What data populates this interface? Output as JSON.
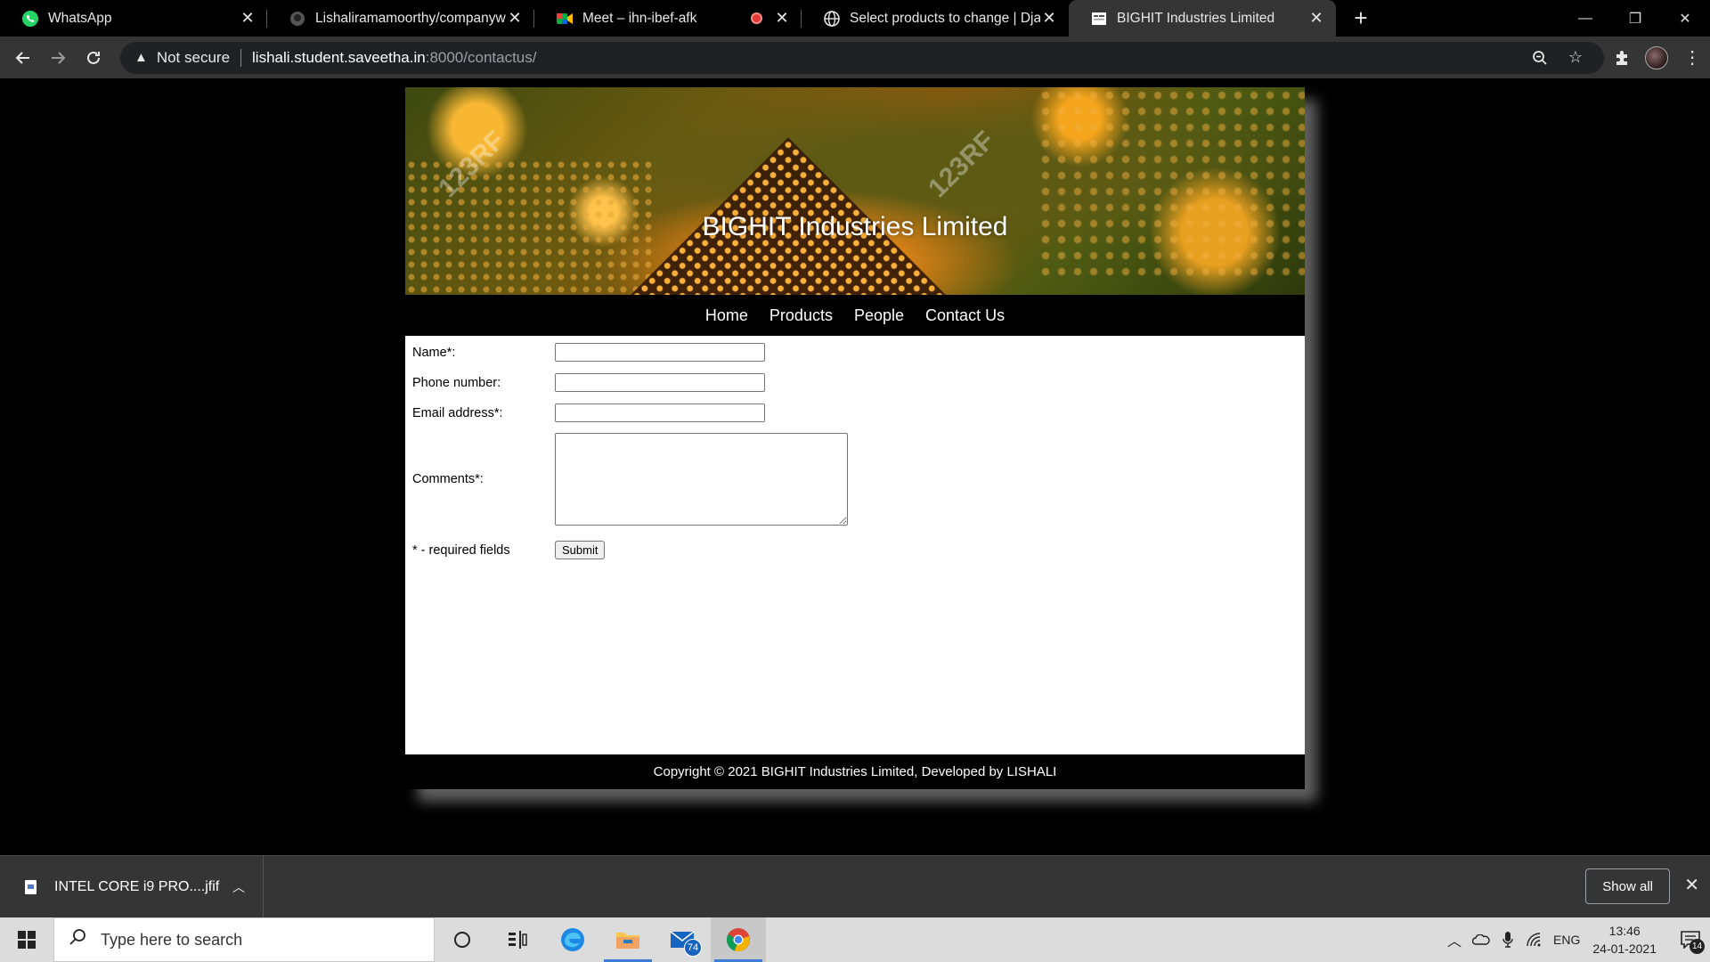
{
  "browser": {
    "tabs": [
      {
        "title": "WhatsApp",
        "icon": "whatsapp-icon",
        "active": false
      },
      {
        "title": "Lishaliramamoorthy/companywebsite",
        "icon": "github-icon",
        "active": false
      },
      {
        "title": "Meet – ihn-ibef-afk",
        "icon": "meet-icon",
        "active": false,
        "recording": true
      },
      {
        "title": "Select products to change | Django site admin",
        "icon": "globe-icon",
        "active": false
      },
      {
        "title": "BIGHIT Industries Limited",
        "icon": "page-icon",
        "active": true
      }
    ],
    "security_label": "Not secure",
    "url_host": "lishali.student.saveetha.in",
    "url_path": ":8000/contactus/",
    "window_controls": {
      "minimize": "—",
      "restore": "❐",
      "close": "✕"
    }
  },
  "site": {
    "banner_title": "BIGHIT Industries Limited",
    "watermark": "123RF",
    "nav": [
      "Home",
      "Products",
      "People",
      "Contact Us"
    ],
    "form": {
      "name_label": "Name*:",
      "phone_label": "Phone number:",
      "email_label": "Email address*:",
      "comments_label": "Comments*:",
      "required_note": "* - required fields",
      "submit_label": "Submit",
      "name_value": "",
      "phone_value": "",
      "email_value": "",
      "comments_value": ""
    },
    "footer": "Copyright © 2021 BIGHIT Industries Limited, Developed by LISHALI"
  },
  "downloads": {
    "file_name": "INTEL CORE i9 PRO....jfif",
    "show_all_label": "Show all"
  },
  "taskbar": {
    "search_placeholder": "Type here to search",
    "mail_badge": "74",
    "language": "ENG",
    "time": "13:46",
    "date": "24-01-2021",
    "notification_count": "14"
  },
  "colors": {
    "chrome_dark": "#353535",
    "page_bg": "#000000",
    "content_bg": "#ffffff",
    "taskbar_bg": "#dcdcdc"
  }
}
